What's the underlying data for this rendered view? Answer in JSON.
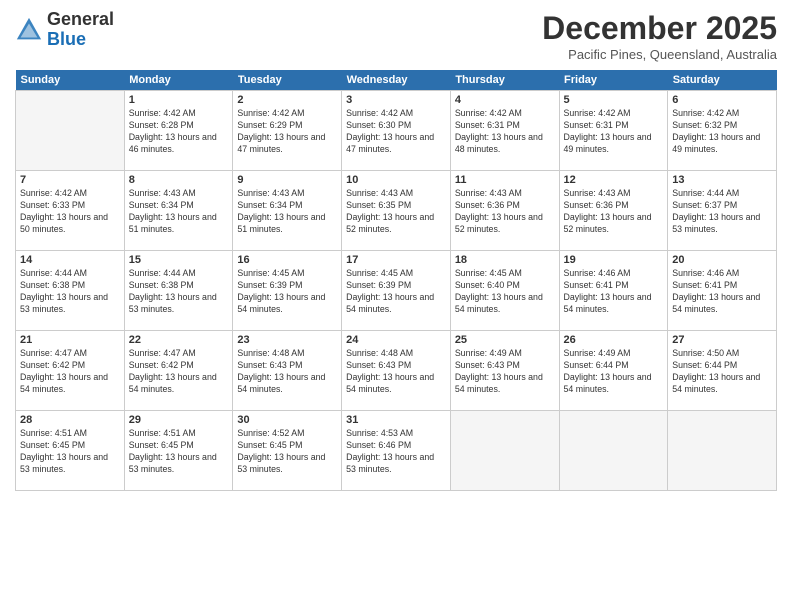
{
  "header": {
    "logo_general": "General",
    "logo_blue": "Blue",
    "month_title": "December 2025",
    "location": "Pacific Pines, Queensland, Australia"
  },
  "days_of_week": [
    "Sunday",
    "Monday",
    "Tuesday",
    "Wednesday",
    "Thursday",
    "Friday",
    "Saturday"
  ],
  "weeks": [
    [
      {
        "day": "",
        "empty": true
      },
      {
        "day": "1",
        "sunrise": "Sunrise: 4:42 AM",
        "sunset": "Sunset: 6:28 PM",
        "daylight": "Daylight: 13 hours and 46 minutes."
      },
      {
        "day": "2",
        "sunrise": "Sunrise: 4:42 AM",
        "sunset": "Sunset: 6:29 PM",
        "daylight": "Daylight: 13 hours and 47 minutes."
      },
      {
        "day": "3",
        "sunrise": "Sunrise: 4:42 AM",
        "sunset": "Sunset: 6:30 PM",
        "daylight": "Daylight: 13 hours and 47 minutes."
      },
      {
        "day": "4",
        "sunrise": "Sunrise: 4:42 AM",
        "sunset": "Sunset: 6:31 PM",
        "daylight": "Daylight: 13 hours and 48 minutes."
      },
      {
        "day": "5",
        "sunrise": "Sunrise: 4:42 AM",
        "sunset": "Sunset: 6:31 PM",
        "daylight": "Daylight: 13 hours and 49 minutes."
      },
      {
        "day": "6",
        "sunrise": "Sunrise: 4:42 AM",
        "sunset": "Sunset: 6:32 PM",
        "daylight": "Daylight: 13 hours and 49 minutes."
      }
    ],
    [
      {
        "day": "7",
        "sunrise": "Sunrise: 4:42 AM",
        "sunset": "Sunset: 6:33 PM",
        "daylight": "Daylight: 13 hours and 50 minutes."
      },
      {
        "day": "8",
        "sunrise": "Sunrise: 4:43 AM",
        "sunset": "Sunset: 6:34 PM",
        "daylight": "Daylight: 13 hours and 51 minutes."
      },
      {
        "day": "9",
        "sunrise": "Sunrise: 4:43 AM",
        "sunset": "Sunset: 6:34 PM",
        "daylight": "Daylight: 13 hours and 51 minutes."
      },
      {
        "day": "10",
        "sunrise": "Sunrise: 4:43 AM",
        "sunset": "Sunset: 6:35 PM",
        "daylight": "Daylight: 13 hours and 52 minutes."
      },
      {
        "day": "11",
        "sunrise": "Sunrise: 4:43 AM",
        "sunset": "Sunset: 6:36 PM",
        "daylight": "Daylight: 13 hours and 52 minutes."
      },
      {
        "day": "12",
        "sunrise": "Sunrise: 4:43 AM",
        "sunset": "Sunset: 6:36 PM",
        "daylight": "Daylight: 13 hours and 52 minutes."
      },
      {
        "day": "13",
        "sunrise": "Sunrise: 4:44 AM",
        "sunset": "Sunset: 6:37 PM",
        "daylight": "Daylight: 13 hours and 53 minutes."
      }
    ],
    [
      {
        "day": "14",
        "sunrise": "Sunrise: 4:44 AM",
        "sunset": "Sunset: 6:38 PM",
        "daylight": "Daylight: 13 hours and 53 minutes."
      },
      {
        "day": "15",
        "sunrise": "Sunrise: 4:44 AM",
        "sunset": "Sunset: 6:38 PM",
        "daylight": "Daylight: 13 hours and 53 minutes."
      },
      {
        "day": "16",
        "sunrise": "Sunrise: 4:45 AM",
        "sunset": "Sunset: 6:39 PM",
        "daylight": "Daylight: 13 hours and 54 minutes."
      },
      {
        "day": "17",
        "sunrise": "Sunrise: 4:45 AM",
        "sunset": "Sunset: 6:39 PM",
        "daylight": "Daylight: 13 hours and 54 minutes."
      },
      {
        "day": "18",
        "sunrise": "Sunrise: 4:45 AM",
        "sunset": "Sunset: 6:40 PM",
        "daylight": "Daylight: 13 hours and 54 minutes."
      },
      {
        "day": "19",
        "sunrise": "Sunrise: 4:46 AM",
        "sunset": "Sunset: 6:41 PM",
        "daylight": "Daylight: 13 hours and 54 minutes."
      },
      {
        "day": "20",
        "sunrise": "Sunrise: 4:46 AM",
        "sunset": "Sunset: 6:41 PM",
        "daylight": "Daylight: 13 hours and 54 minutes."
      }
    ],
    [
      {
        "day": "21",
        "sunrise": "Sunrise: 4:47 AM",
        "sunset": "Sunset: 6:42 PM",
        "daylight": "Daylight: 13 hours and 54 minutes."
      },
      {
        "day": "22",
        "sunrise": "Sunrise: 4:47 AM",
        "sunset": "Sunset: 6:42 PM",
        "daylight": "Daylight: 13 hours and 54 minutes."
      },
      {
        "day": "23",
        "sunrise": "Sunrise: 4:48 AM",
        "sunset": "Sunset: 6:43 PM",
        "daylight": "Daylight: 13 hours and 54 minutes."
      },
      {
        "day": "24",
        "sunrise": "Sunrise: 4:48 AM",
        "sunset": "Sunset: 6:43 PM",
        "daylight": "Daylight: 13 hours and 54 minutes."
      },
      {
        "day": "25",
        "sunrise": "Sunrise: 4:49 AM",
        "sunset": "Sunset: 6:43 PM",
        "daylight": "Daylight: 13 hours and 54 minutes."
      },
      {
        "day": "26",
        "sunrise": "Sunrise: 4:49 AM",
        "sunset": "Sunset: 6:44 PM",
        "daylight": "Daylight: 13 hours and 54 minutes."
      },
      {
        "day": "27",
        "sunrise": "Sunrise: 4:50 AM",
        "sunset": "Sunset: 6:44 PM",
        "daylight": "Daylight: 13 hours and 54 minutes."
      }
    ],
    [
      {
        "day": "28",
        "sunrise": "Sunrise: 4:51 AM",
        "sunset": "Sunset: 6:45 PM",
        "daylight": "Daylight: 13 hours and 53 minutes."
      },
      {
        "day": "29",
        "sunrise": "Sunrise: 4:51 AM",
        "sunset": "Sunset: 6:45 PM",
        "daylight": "Daylight: 13 hours and 53 minutes."
      },
      {
        "day": "30",
        "sunrise": "Sunrise: 4:52 AM",
        "sunset": "Sunset: 6:45 PM",
        "daylight": "Daylight: 13 hours and 53 minutes."
      },
      {
        "day": "31",
        "sunrise": "Sunrise: 4:53 AM",
        "sunset": "Sunset: 6:46 PM",
        "daylight": "Daylight: 13 hours and 53 minutes."
      },
      {
        "day": "",
        "empty": true
      },
      {
        "day": "",
        "empty": true
      },
      {
        "day": "",
        "empty": true
      }
    ]
  ]
}
